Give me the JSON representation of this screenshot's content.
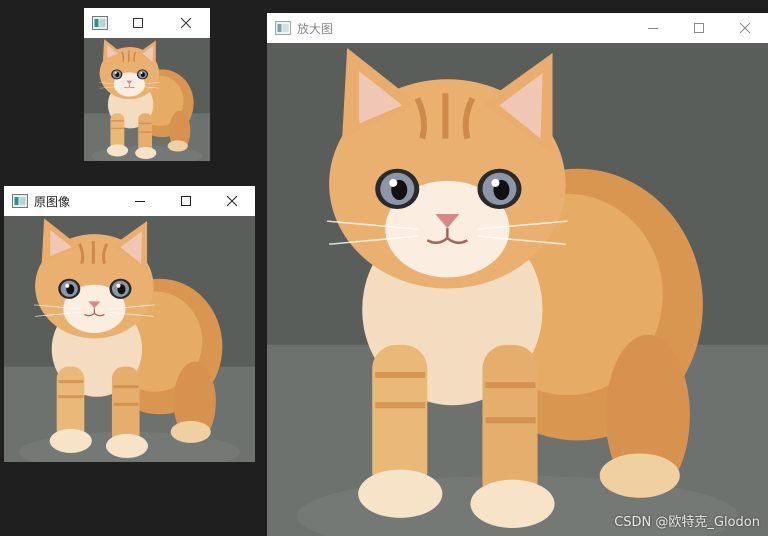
{
  "windows": {
    "thumbnail": {
      "title": ""
    },
    "original": {
      "title": "原图像"
    },
    "enlarged": {
      "title": "放大图"
    }
  },
  "icons": {
    "app": "opencv-window-icon",
    "minimize": "minimize-icon",
    "maximize": "maximize-icon",
    "close": "close-icon"
  },
  "content": {
    "subject": "orange tabby kitten photo"
  },
  "watermark": {
    "text": "CSDN @欧特克_Glodon"
  },
  "colors": {
    "desktop": "#1f1f1f",
    "titlebar": "#ffffff",
    "photo_background": "#565a57",
    "fur": "#e3a55f"
  }
}
